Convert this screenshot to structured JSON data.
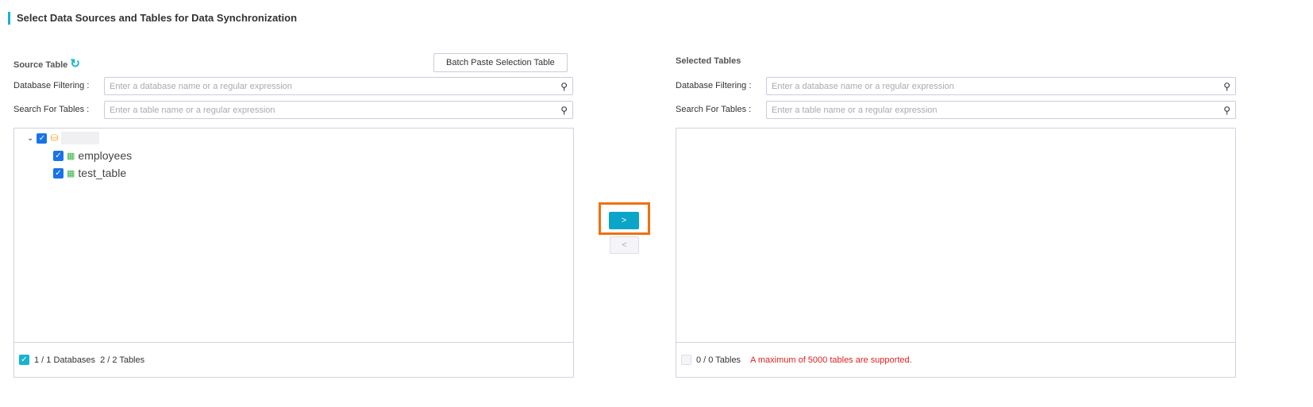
{
  "title": "Select Data Sources and Tables for Data Synchronization",
  "source": {
    "heading": "Source Table",
    "batch_button": "Batch Paste Selection Table",
    "db_filter_label": "Database Filtering :",
    "db_filter_placeholder": "Enter a database name or a regular expression",
    "table_search_label": "Search For Tables :",
    "table_search_placeholder": "Enter a table name or a regular expression",
    "tables": [
      "employees",
      "test_table"
    ],
    "footer_databases": "1 / 1 Databases",
    "footer_tables": "2 / 2 Tables"
  },
  "transfer": {
    "move_right": ">",
    "move_left": "<"
  },
  "selected": {
    "heading": "Selected Tables",
    "db_filter_label": "Database Filtering :",
    "db_filter_placeholder": "Enter a database name or a regular expression",
    "table_search_label": "Search For Tables :",
    "table_search_placeholder": "Enter a table name or a regular expression",
    "footer_tables": "0 / 0 Tables",
    "warning": "A maximum of 5000 tables are supported."
  },
  "colors": {
    "accent": "#17b3d0",
    "primary_btn": "#0aa5c8",
    "highlight": "#f07010",
    "warning": "#e02020"
  }
}
